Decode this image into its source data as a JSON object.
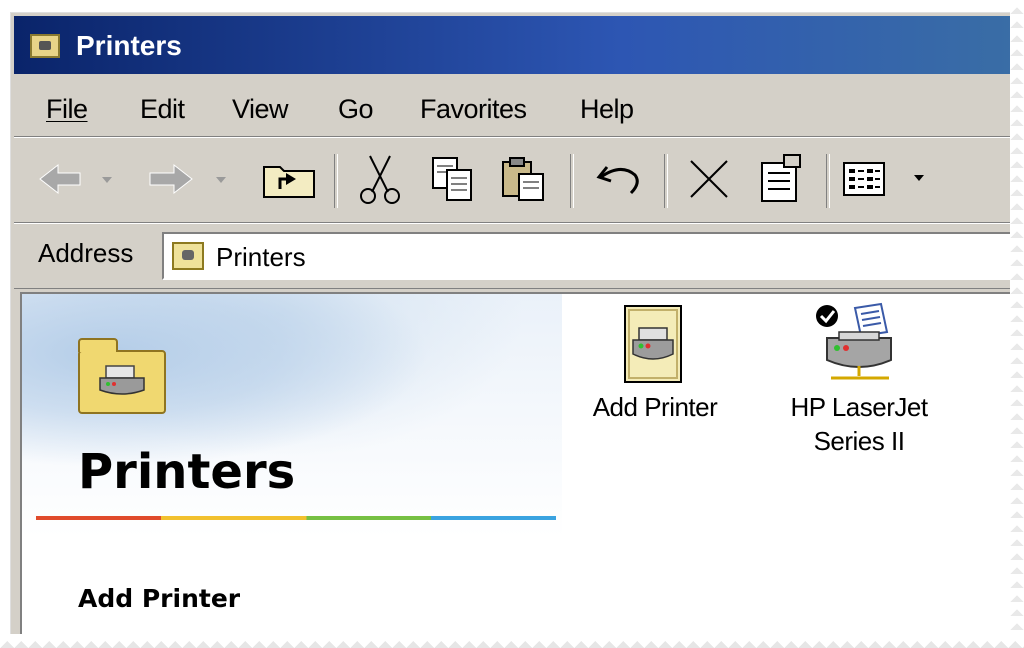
{
  "window": {
    "title": "Printers"
  },
  "menubar": {
    "items": [
      {
        "label": "File"
      },
      {
        "label": "Edit"
      },
      {
        "label": "View"
      },
      {
        "label": "Go"
      },
      {
        "label": "Favorites"
      },
      {
        "label": "Help"
      }
    ]
  },
  "toolbar": {
    "buttons": [
      {
        "name": "back",
        "icon": "back-arrow-icon",
        "enabled": false
      },
      {
        "name": "forward",
        "icon": "forward-arrow-icon",
        "enabled": false
      },
      {
        "name": "up",
        "icon": "up-folder-icon",
        "enabled": true
      },
      {
        "name": "cut",
        "icon": "scissors-icon",
        "enabled": true
      },
      {
        "name": "copy",
        "icon": "copy-icon",
        "enabled": true
      },
      {
        "name": "paste",
        "icon": "paste-icon",
        "enabled": true
      },
      {
        "name": "undo",
        "icon": "undo-icon",
        "enabled": true
      },
      {
        "name": "delete",
        "icon": "delete-x-icon",
        "enabled": true
      },
      {
        "name": "properties",
        "icon": "properties-icon",
        "enabled": true
      },
      {
        "name": "views",
        "icon": "views-icon",
        "enabled": true
      }
    ]
  },
  "address": {
    "label": "Address",
    "value": "Printers"
  },
  "webview": {
    "title": "Printers",
    "task_heading": "Add Printer"
  },
  "items": [
    {
      "label": "Add Printer",
      "icon": "add-printer-icon"
    },
    {
      "label_line1": "HP LaserJet",
      "label_line2": "Series II",
      "icon": "default-printer-icon",
      "is_default": true
    }
  ],
  "colors": {
    "titlebar_start": "#0a246a",
    "titlebar_end": "#3a6ea5",
    "chrome": "#d4d0c8",
    "rainbow": [
      "#e04b2b",
      "#f2c12e",
      "#76c043",
      "#3aa3e0"
    ]
  }
}
